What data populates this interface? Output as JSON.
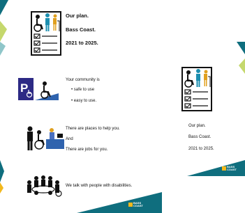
{
  "left_page": {
    "plan_title": "Our plan.",
    "region": "Bass Coast.",
    "years": "2021  to  2025.",
    "community_heading": "Your community is",
    "bullets": [
      "safe to use",
      "easy to use."
    ],
    "places_line1": "There are places to help you.",
    "places_line2": "And",
    "places_line3": "There are jobs for you.",
    "disabilities_line": "We talk with people with disabilities.",
    "logo_word1": "BASS",
    "logo_word2": "COAST"
  },
  "right_page": {
    "plan_title": "Our plan.",
    "region": "Bass Coast.",
    "years": "2021  to  2025.",
    "logo_word1": "BASS",
    "logo_word2": "COAST"
  },
  "colors": {
    "teal": "#0f6e7e",
    "lime": "#c5d86d",
    "yellow": "#f2b81d",
    "navy": "#2d2a85",
    "blue": "#2f63ae"
  }
}
